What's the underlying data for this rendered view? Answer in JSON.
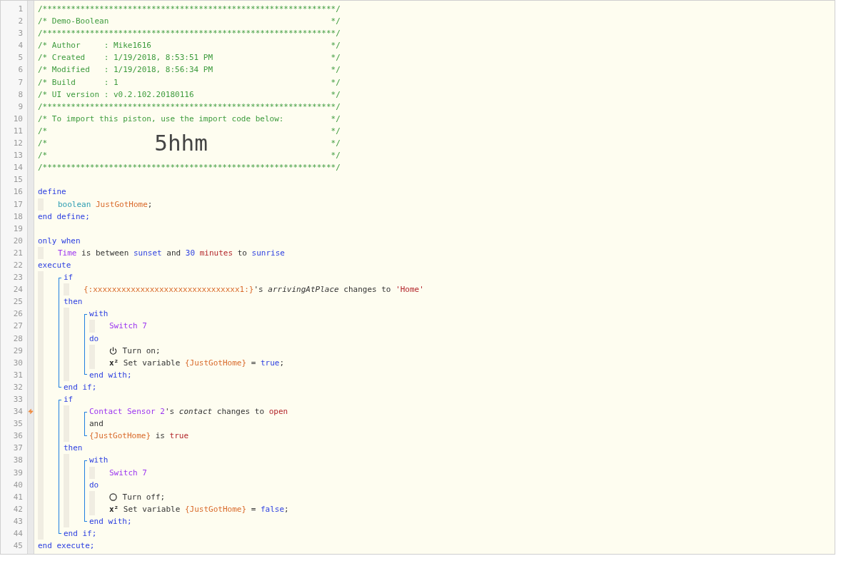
{
  "lines": [
    {
      "kind": "line",
      "number": "1",
      "trigger": false,
      "tokens": [
        {
          "kind": "comment",
          "text": "/**************************************************************/"
        }
      ]
    },
    {
      "kind": "line",
      "number": "2",
      "trigger": false,
      "tokens": [
        {
          "kind": "comment",
          "text": "/* Demo-Boolean"
        },
        {
          "kind": "comment_end",
          "text": "*/"
        }
      ]
    },
    {
      "kind": "line",
      "number": "3",
      "trigger": false,
      "tokens": [
        {
          "kind": "comment",
          "text": "/**************************************************************/"
        }
      ]
    },
    {
      "kind": "line",
      "number": "4",
      "trigger": false,
      "tokens": [
        {
          "kind": "comment",
          "text": "/* Author     : Mike1616"
        },
        {
          "kind": "comment_end",
          "text": "*/"
        }
      ]
    },
    {
      "kind": "line",
      "number": "5",
      "trigger": false,
      "tokens": [
        {
          "kind": "comment",
          "text": "/* Created    : 1/19/2018, 8:53:51 PM"
        },
        {
          "kind": "comment_end",
          "text": "*/"
        }
      ]
    },
    {
      "kind": "line",
      "number": "6",
      "trigger": false,
      "tokens": [
        {
          "kind": "comment",
          "text": "/* Modified   : 1/19/2018, 8:56:34 PM"
        },
        {
          "kind": "comment_end",
          "text": "*/"
        }
      ]
    },
    {
      "kind": "line",
      "number": "7",
      "trigger": false,
      "tokens": [
        {
          "kind": "comment",
          "text": "/* Build      : 1"
        },
        {
          "kind": "comment_end",
          "text": "*/"
        }
      ]
    },
    {
      "kind": "line",
      "number": "8",
      "trigger": false,
      "tokens": [
        {
          "kind": "comment",
          "text": "/* UI version : v0.2.102.20180116"
        },
        {
          "kind": "comment_end",
          "text": "*/"
        }
      ]
    },
    {
      "kind": "line",
      "number": "9",
      "trigger": false,
      "tokens": [
        {
          "kind": "comment",
          "text": "/**************************************************************/"
        }
      ]
    },
    {
      "kind": "line",
      "number": "10",
      "trigger": false,
      "tokens": [
        {
          "kind": "comment",
          "text": "/* To import this piston, use the import code below:"
        },
        {
          "kind": "comment_end",
          "text": "*/"
        }
      ]
    },
    {
      "kind": "line",
      "number": "11",
      "trigger": false,
      "tokens": [
        {
          "kind": "comment",
          "text": "/*"
        },
        {
          "kind": "comment_end",
          "text": "*/"
        }
      ]
    },
    {
      "kind": "line",
      "number": "12",
      "trigger": false,
      "tokens": [
        {
          "kind": "comment",
          "text": "/*"
        },
        {
          "kind": "import_code",
          "text": "5hhm"
        },
        {
          "kind": "comment_end",
          "text": "*/"
        }
      ]
    },
    {
      "kind": "line",
      "number": "13",
      "trigger": false,
      "tokens": [
        {
          "kind": "comment",
          "text": "/*"
        },
        {
          "kind": "comment_end",
          "text": "*/"
        }
      ]
    },
    {
      "kind": "line",
      "number": "14",
      "trigger": false,
      "tokens": [
        {
          "kind": "comment",
          "text": "/**************************************************************/"
        }
      ]
    },
    {
      "kind": "line",
      "number": "15",
      "trigger": false
    },
    {
      "kind": "line",
      "number": "16",
      "trigger": false,
      "tokens": [
        {
          "kind": "keyword",
          "text": "define"
        }
      ],
      "children": [
        {
          "kind": "line",
          "number": "17",
          "trigger": false,
          "tokens": [
            {
              "kind": "type",
              "text": "boolean "
            },
            {
              "kind": "variable",
              "text": "JustGotHome"
            },
            {
              "kind": "plain",
              "text": ";"
            }
          ]
        }
      ]
    },
    {
      "kind": "line",
      "number": "18",
      "trigger": false,
      "tokens": [
        {
          "kind": "keyword",
          "text": "end define;"
        }
      ]
    },
    {
      "kind": "line",
      "number": "19",
      "trigger": false
    },
    {
      "kind": "line",
      "number": "20",
      "trigger": false,
      "tokens": [
        {
          "kind": "keyword",
          "text": "only when"
        }
      ],
      "children": [
        {
          "kind": "line",
          "number": "21",
          "trigger": false,
          "tokens": [
            {
              "kind": "device",
              "text": "Time"
            },
            {
              "kind": "plain",
              "text": " is between "
            },
            {
              "kind": "keyword",
              "text": "sunset"
            },
            {
              "kind": "plain",
              "text": " and "
            },
            {
              "kind": "keyword",
              "text": "30"
            },
            {
              "kind": "string",
              "text": " minutes"
            },
            {
              "kind": "plain",
              "text": " to "
            },
            {
              "kind": "keyword",
              "text": "sunrise"
            }
          ]
        }
      ]
    },
    {
      "kind": "line",
      "number": "22",
      "trigger": false,
      "tokens": [
        {
          "kind": "keyword",
          "text": "execute"
        }
      ],
      "children": [
        {
          "kind": "group",
          "items": [
            {
              "kind": "line",
              "number": "23",
              "trigger": false,
              "tokens": [
                {
                  "kind": "keyword",
                  "text": "if"
                }
              ],
              "children": [
                {
                  "kind": "line",
                  "number": "24",
                  "trigger": false,
                  "tokens": [
                    {
                      "kind": "variable",
                      "text": "{:xxxxxxxxxxxxxxxxxxxxxxxxxxxxxxx1:}"
                    },
                    {
                      "kind": "plain",
                      "text": "'s "
                    },
                    {
                      "kind": "attribute",
                      "text": "arrivingAtPlace"
                    },
                    {
                      "kind": "plain",
                      "text": " changes to "
                    },
                    {
                      "kind": "string",
                      "text": "'Home'"
                    }
                  ]
                }
              ]
            },
            {
              "kind": "line",
              "number": "25",
              "trigger": false,
              "tokens": [
                {
                  "kind": "keyword",
                  "text": "then"
                }
              ],
              "children": [
                {
                  "kind": "group",
                  "items": [
                    {
                      "kind": "line",
                      "number": "26",
                      "trigger": false,
                      "tokens": [
                        {
                          "kind": "keyword",
                          "text": "with"
                        }
                      ],
                      "children": [
                        {
                          "kind": "line",
                          "number": "27",
                          "trigger": false,
                          "tokens": [
                            {
                              "kind": "device",
                              "text": "Switch 7"
                            }
                          ]
                        }
                      ]
                    },
                    {
                      "kind": "line",
                      "number": "28",
                      "trigger": false,
                      "tokens": [
                        {
                          "kind": "keyword",
                          "text": "do"
                        }
                      ],
                      "children": [
                        {
                          "kind": "line",
                          "number": "29",
                          "trigger": false,
                          "tokens": [
                            {
                              "kind": "power",
                              "on": true
                            },
                            {
                              "kind": "plain",
                              "text": " Turn on;"
                            }
                          ]
                        },
                        {
                          "kind": "line",
                          "number": "30",
                          "trigger": false,
                          "tokens": [
                            {
                              "kind": "symbol",
                              "text": "x²"
                            },
                            {
                              "kind": "plain",
                              "text": " Set variable "
                            },
                            {
                              "kind": "variable",
                              "text": "{JustGotHome}"
                            },
                            {
                              "kind": "plain",
                              "text": " = "
                            },
                            {
                              "kind": "keyword",
                              "text": "true"
                            },
                            {
                              "kind": "plain",
                              "text": ";"
                            }
                          ]
                        }
                      ]
                    },
                    {
                      "kind": "line",
                      "number": "31",
                      "trigger": false,
                      "tokens": [
                        {
                          "kind": "keyword",
                          "text": "end with;"
                        }
                      ]
                    }
                  ]
                }
              ]
            },
            {
              "kind": "line",
              "number": "32",
              "trigger": false,
              "tokens": [
                {
                  "kind": "keyword",
                  "text": "end if;"
                }
              ]
            }
          ]
        },
        {
          "kind": "group",
          "items": [
            {
              "kind": "line",
              "number": "33",
              "trigger": false,
              "tokens": [
                {
                  "kind": "keyword",
                  "text": "if"
                }
              ],
              "children": [
                {
                  "kind": "group",
                  "items": [
                    {
                      "kind": "line",
                      "number": "34",
                      "trigger": true,
                      "tokens": [
                        {
                          "kind": "device",
                          "text": "Contact Sensor 2"
                        },
                        {
                          "kind": "plain",
                          "text": "'s "
                        },
                        {
                          "kind": "attribute",
                          "text": "contact"
                        },
                        {
                          "kind": "plain",
                          "text": " changes to "
                        },
                        {
                          "kind": "string",
                          "text": "open"
                        }
                      ]
                    },
                    {
                      "kind": "line",
                      "number": "35",
                      "trigger": false,
                      "tokens": [
                        {
                          "kind": "plain",
                          "text": "and"
                        }
                      ]
                    },
                    {
                      "kind": "line",
                      "number": "36",
                      "trigger": false,
                      "tokens": [
                        {
                          "kind": "variable",
                          "text": "{JustGotHome}"
                        },
                        {
                          "kind": "plain",
                          "text": " is "
                        },
                        {
                          "kind": "string",
                          "text": "true"
                        }
                      ]
                    }
                  ]
                }
              ]
            },
            {
              "kind": "line",
              "number": "37",
              "trigger": false,
              "tokens": [
                {
                  "kind": "keyword",
                  "text": "then"
                }
              ],
              "children": [
                {
                  "kind": "group",
                  "items": [
                    {
                      "kind": "line",
                      "number": "38",
                      "trigger": false,
                      "tokens": [
                        {
                          "kind": "keyword",
                          "text": "with"
                        }
                      ],
                      "children": [
                        {
                          "kind": "line",
                          "number": "39",
                          "trigger": false,
                          "tokens": [
                            {
                              "kind": "device",
                              "text": "Switch 7"
                            }
                          ]
                        }
                      ]
                    },
                    {
                      "kind": "line",
                      "number": "40",
                      "trigger": false,
                      "tokens": [
                        {
                          "kind": "keyword",
                          "text": "do"
                        }
                      ],
                      "children": [
                        {
                          "kind": "line",
                          "number": "41",
                          "trigger": false,
                          "tokens": [
                            {
                              "kind": "power",
                              "on": false
                            },
                            {
                              "kind": "plain",
                              "text": " Turn off;"
                            }
                          ]
                        },
                        {
                          "kind": "line",
                          "number": "42",
                          "trigger": false,
                          "tokens": [
                            {
                              "kind": "symbol",
                              "text": "x²"
                            },
                            {
                              "kind": "plain",
                              "text": " Set variable "
                            },
                            {
                              "kind": "variable",
                              "text": "{JustGotHome}"
                            },
                            {
                              "kind": "plain",
                              "text": " = "
                            },
                            {
                              "kind": "keyword",
                              "text": "false"
                            },
                            {
                              "kind": "plain",
                              "text": ";"
                            }
                          ]
                        }
                      ]
                    },
                    {
                      "kind": "line",
                      "number": "43",
                      "trigger": false,
                      "tokens": [
                        {
                          "kind": "keyword",
                          "text": "end with;"
                        }
                      ]
                    }
                  ]
                }
              ]
            },
            {
              "kind": "line",
              "number": "44",
              "trigger": false,
              "tokens": [
                {
                  "kind": "keyword",
                  "text": "end if;"
                }
              ]
            }
          ]
        }
      ]
    },
    {
      "kind": "line",
      "number": "45",
      "trigger": false,
      "tokens": [
        {
          "kind": "keyword",
          "text": "end execute;"
        }
      ]
    }
  ]
}
